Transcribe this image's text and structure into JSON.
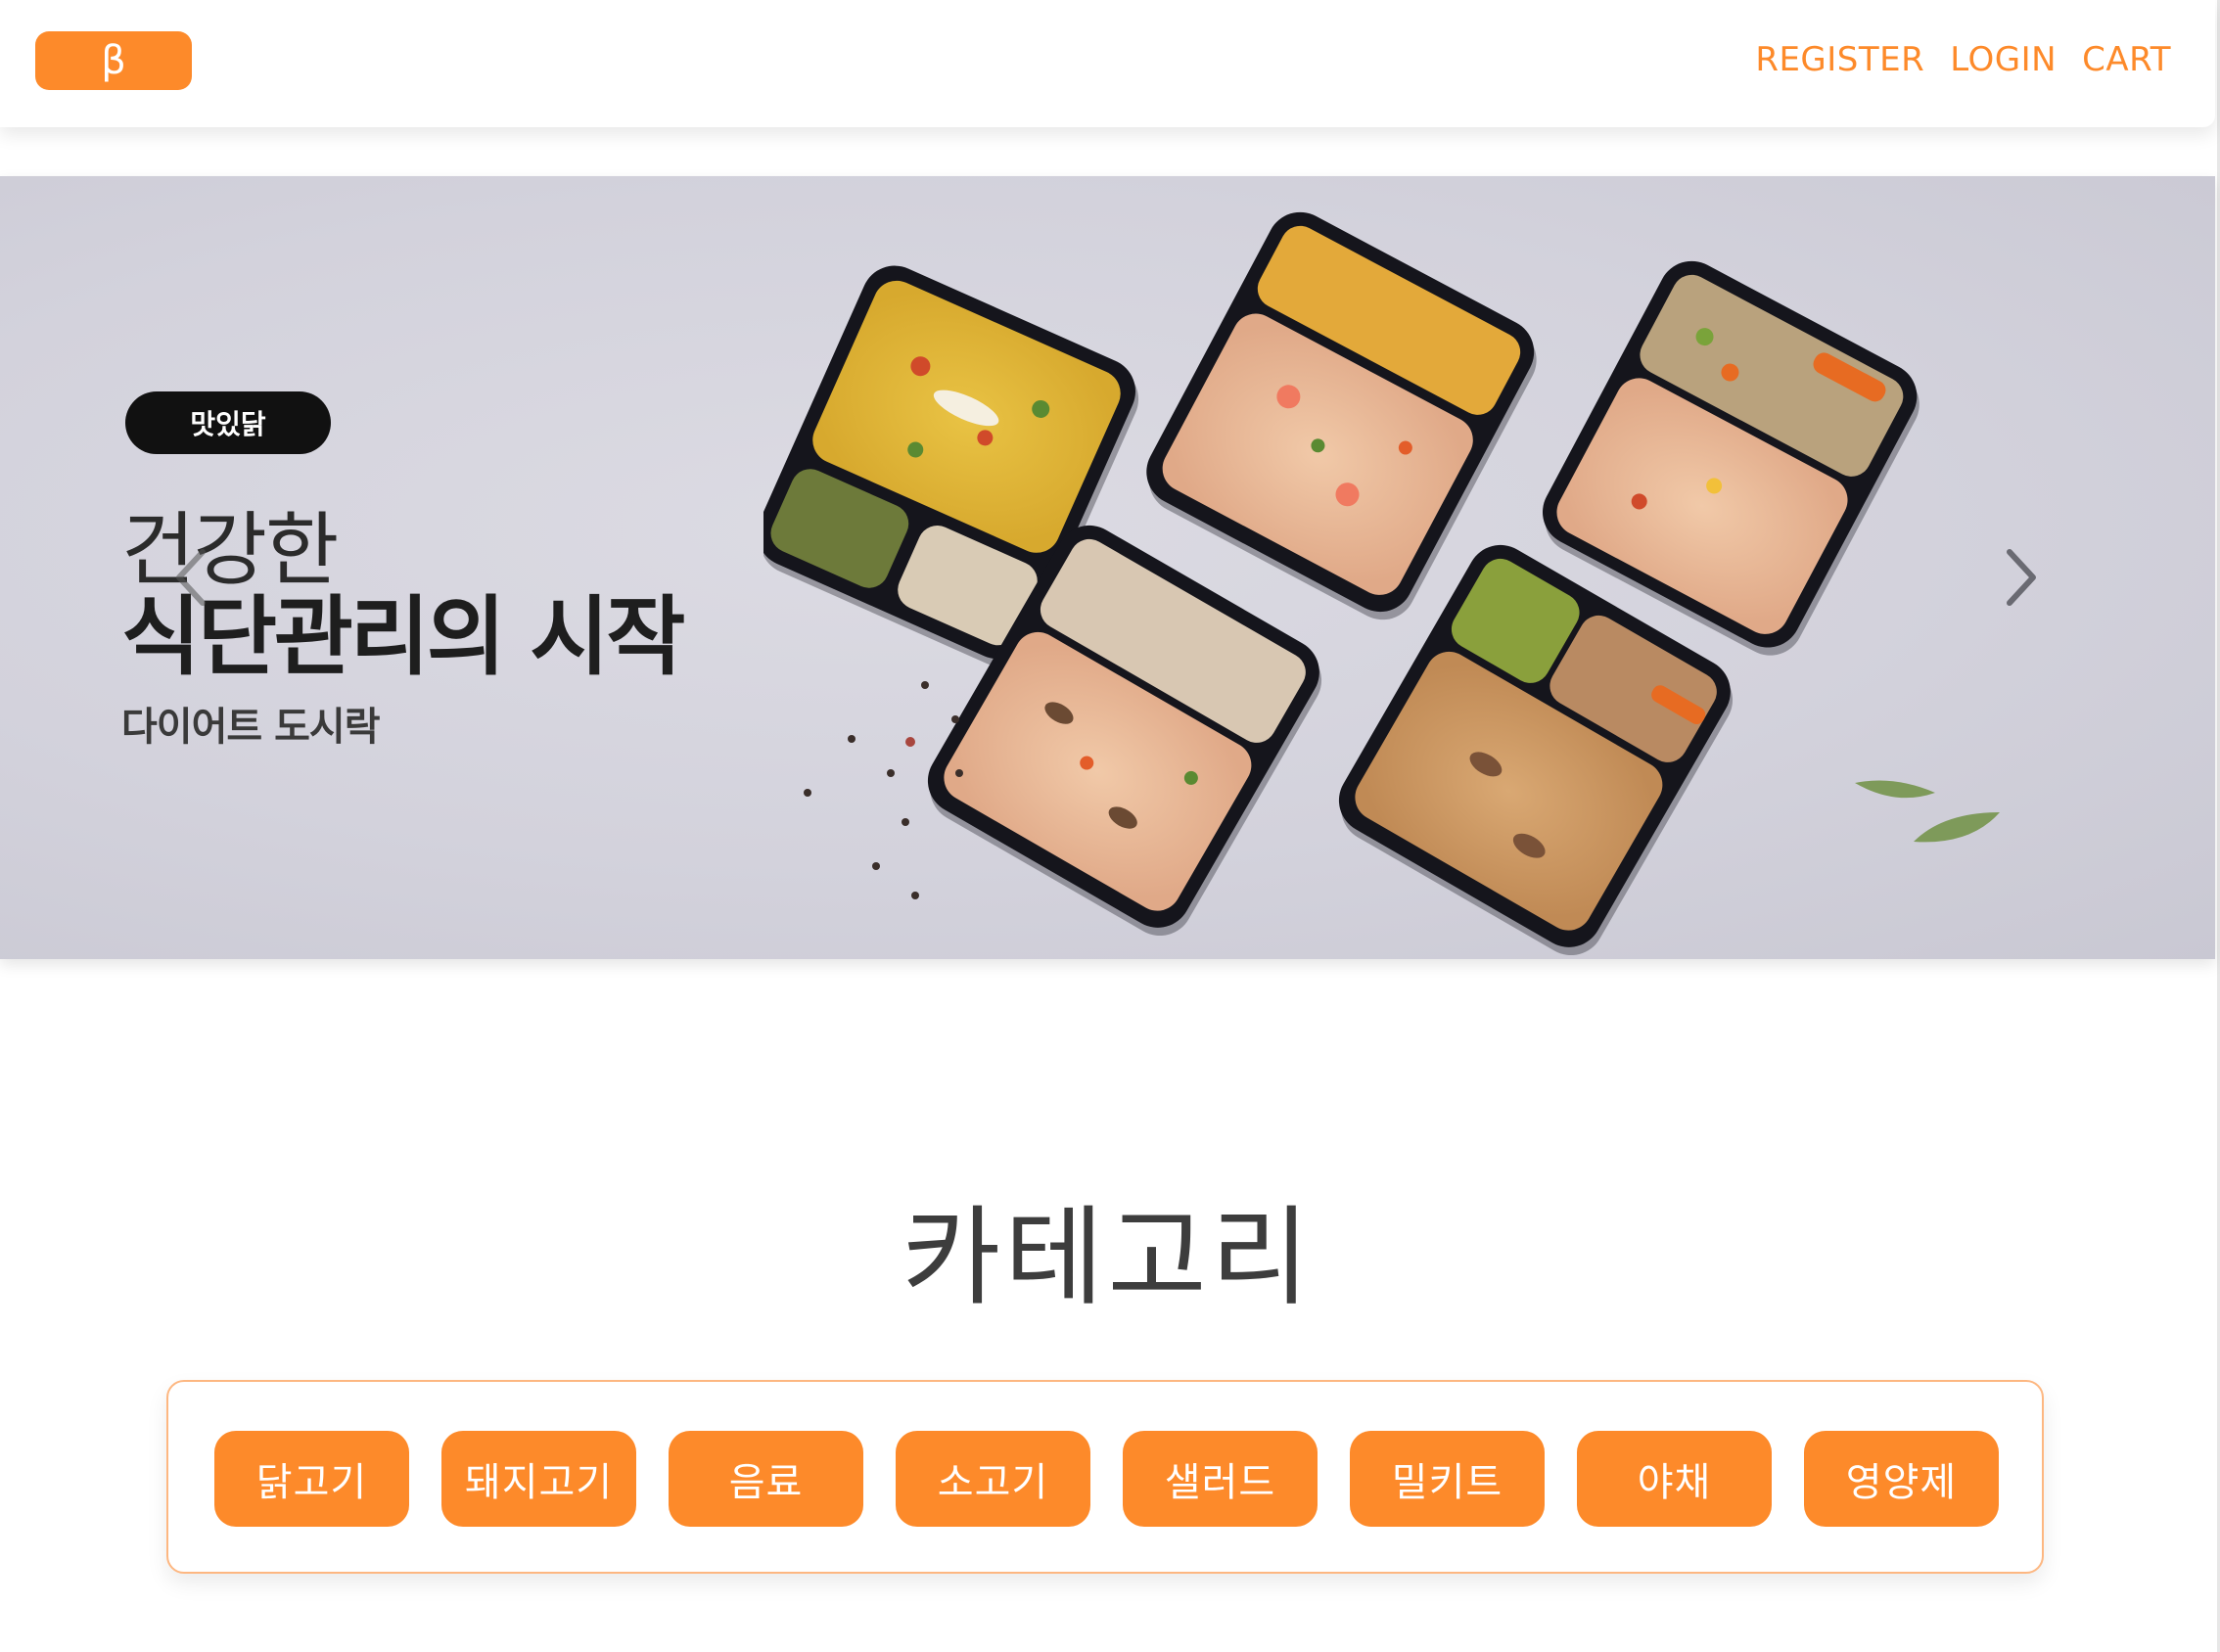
{
  "header": {
    "logo_text": "β",
    "nav": {
      "register": "REGISTER",
      "login": "LOGIN",
      "cart": "CART"
    }
  },
  "banner": {
    "brand": "맛있닭",
    "headline_line1": "건강한",
    "headline_line2": "식단관리의 시작",
    "subline": "다이어트 도시락",
    "prev_icon": "chevron-left-icon",
    "next_icon": "chevron-right-icon"
  },
  "categories": {
    "title": "카테고리",
    "items": [
      "닭고기",
      "돼지고기",
      "음료",
      "소고기",
      "샐러드",
      "밀키트",
      "야채",
      "영양제"
    ]
  },
  "colors": {
    "accent": "#fd8a2a",
    "banner_bg": "#d3d2dc",
    "box_border": "#fdb781"
  }
}
